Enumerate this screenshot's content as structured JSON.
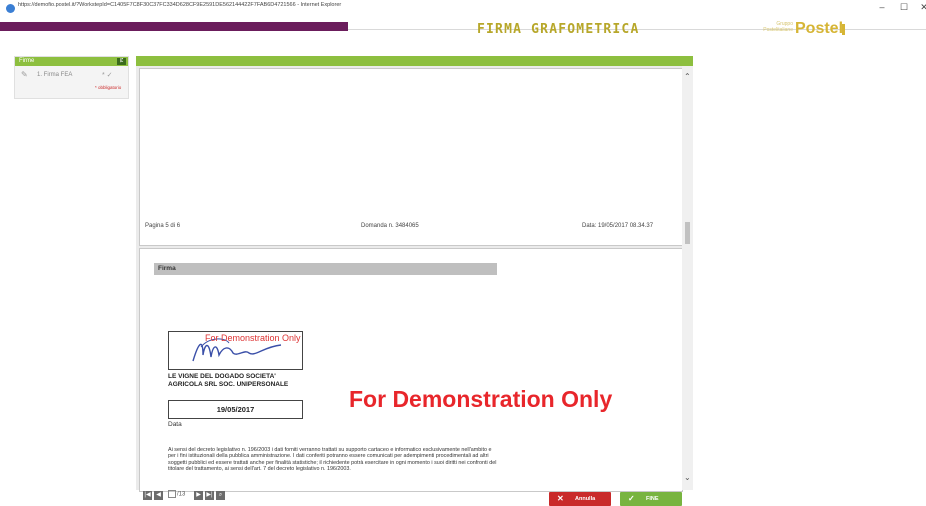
{
  "browser": {
    "url": "https://demofio.postel.it/?WorkstepId=C1405F7C8F30C37FC334D628CF9E2591DE562144422F7FAB6D4721566 - Internet Explorer",
    "minimize": "–",
    "maximize": "☐",
    "close": "✕"
  },
  "header": {
    "title": "FIRMA GRAFOMETRICA",
    "logo_small": "Gruppo Postelitaliane",
    "logo_big": "Postel"
  },
  "sidebar": {
    "title": "Firme",
    "badge": "Ȼ",
    "items": [
      {
        "label": "1. Firma FEA",
        "flags": "* ✓"
      }
    ],
    "required_note": "* obbligatorio"
  },
  "document": {
    "page_footer": {
      "page": "Pagina 5 di 6",
      "domanda": "Domanda n. 3484065",
      "data": "Data: 19/05/2017 08.34.37"
    },
    "section_title": "Firma",
    "signature_demo_text": "For Demonstration Only",
    "company_line1": "LE VIGNE DEL DOGADO SOCIETA'",
    "company_line2": "AGRICOLA SRL SOC. UNIPERSONALE",
    "date_value": "19/05/2017",
    "date_label": "Data",
    "watermark": "For Demonstration Only",
    "legal_text": "Ai sensi del decreto legislativo n. 196/2003 i dati forniti verranno trattati su supporto cartaceo e informatico esclusivamente nell'ambito e per i fini istituzionali della pubblica amministrazione. I dati conferiti potranno essere comunicati per adempimenti procedimentali ad altri soggetti pubblici ed essere trattati anche per finalità statistiche; il richiedente potrà esercitare in ogni momento i suoi diritti nei confronti del titolare del trattamento, ai sensi dell'art. 7 del decreto legislativo n. 196/2003."
  },
  "pager": {
    "first": "|◀",
    "prev": "◀",
    "page_info": "/13",
    "next": "▶",
    "last": "▶|",
    "zoom": "⌕"
  },
  "actions": {
    "cancel_label": "Annulla",
    "cancel_icon": "✕",
    "finish_label": "FINE",
    "finish_icon": "✓"
  }
}
